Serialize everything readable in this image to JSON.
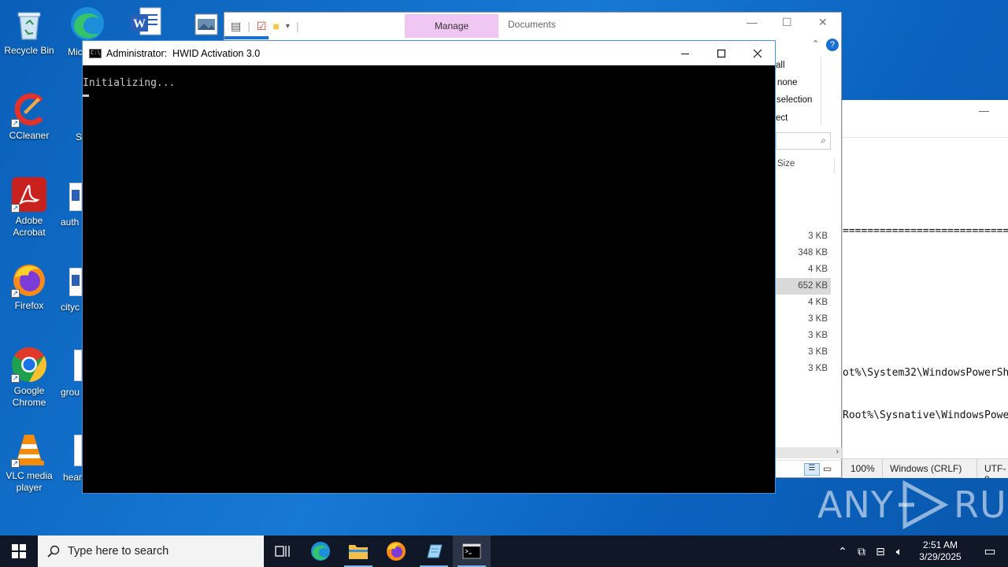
{
  "desktop_icons": [
    {
      "label": "Recycle Bin",
      "icon": "recycle-bin-icon"
    },
    {
      "label": "CCleaner",
      "icon": "ccleaner-icon"
    },
    {
      "label": "Adobe Acrobat",
      "icon": "adobe-acrobat-icon"
    },
    {
      "label": "Firefox",
      "icon": "firefox-icon"
    },
    {
      "label": "Google Chrome",
      "icon": "chrome-icon"
    },
    {
      "label": "VLC media player",
      "icon": "vlc-icon"
    }
  ],
  "cut_icons": [
    "Mic",
    "S",
    "auth",
    "cityc",
    "grou",
    "hear"
  ],
  "explorer": {
    "manage_tab": "Manage",
    "path_label": "Documents",
    "ribbon_items": [
      "all",
      "none",
      "selection",
      "ect"
    ],
    "size_header": "Size",
    "sizes": [
      "3 KB",
      "348 KB",
      "4 KB",
      "652 KB",
      "4 KB",
      "3 KB",
      "3 KB",
      "3 KB",
      "3 KB"
    ],
    "selected_row": 3
  },
  "notepad": {
    "line_sep": "===================================",
    "line_path1": "ot%\\System32\\WindowsPowerSh",
    "line_path2": "Root%\\Sysnative\\WindowsPowe",
    "status_zoom": "100%",
    "status_eol": "Windows (CRLF)",
    "status_enc": "UTF-8"
  },
  "console": {
    "title": "Administrator:  HWID Activation 3.0",
    "output": "Initializing..."
  },
  "watermark": {
    "left": "ANY",
    "right": "RUN"
  },
  "taskbar": {
    "search_placeholder": "Type here to search",
    "time": "2:51 AM",
    "date": "3/29/2025"
  }
}
